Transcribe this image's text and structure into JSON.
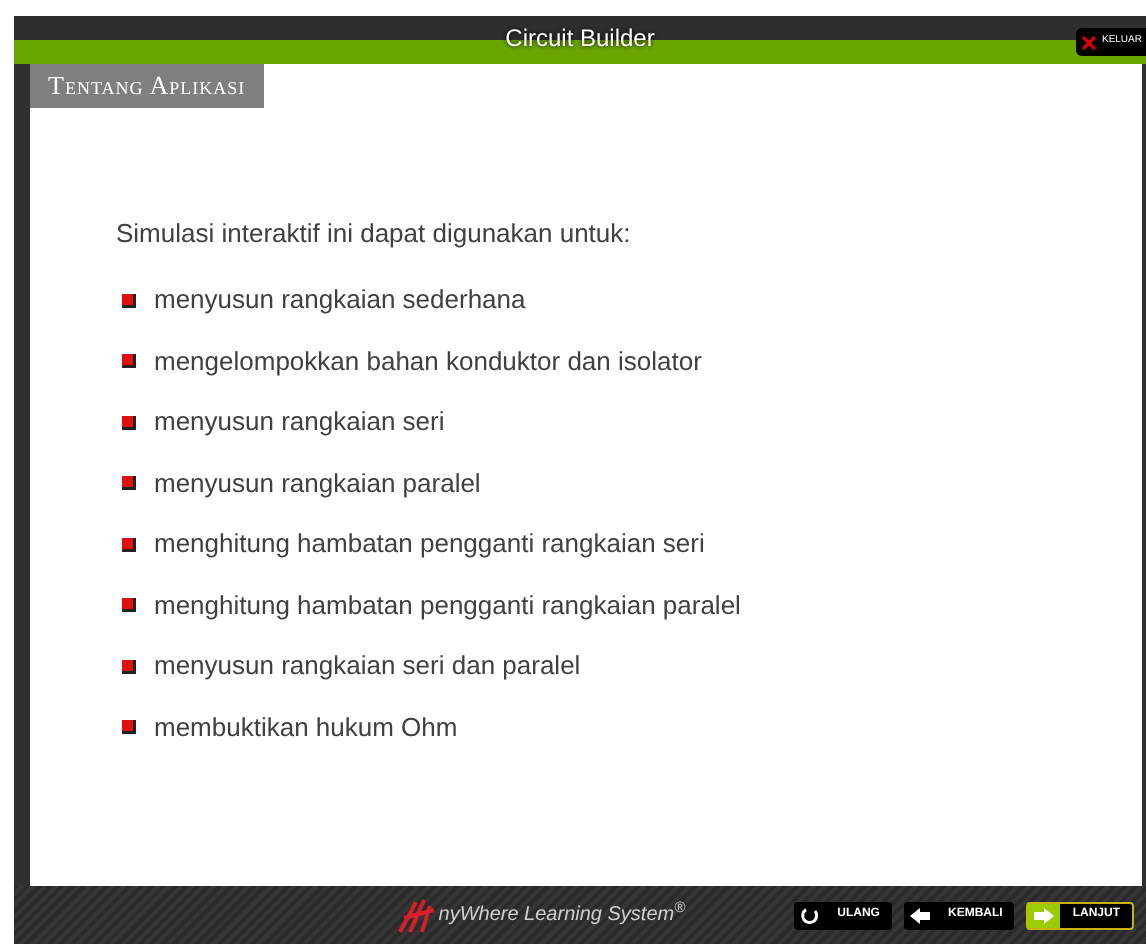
{
  "window": {
    "title": "Circuit Builder",
    "exit_label": "KELUAR"
  },
  "section_title": "Tentang Aplikasi",
  "intro": "Simulasi interaktif ini dapat digunakan untuk:",
  "items": [
    "menyusun rangkaian sederhana",
    "mengelompokkan bahan konduktor dan isolator",
    "menyusun rangkaian seri",
    "menyusun rangkaian paralel",
    "menghitung hambatan pengganti rangkaian seri",
    "menghitung hambatan pengganti rangkaian paralel",
    "menyusun rangkaian seri dan paralel",
    "membuktikan hukum Ohm"
  ],
  "footer": {
    "logo_text": "nyWhere Learning System$^{®}$",
    "buttons": [
      {
        "label": "ULANG",
        "kind": "reload",
        "highlighted": false
      },
      {
        "label": "KEMBALI",
        "kind": "back",
        "highlighted": false
      },
      {
        "label": "LANJUT",
        "kind": "next",
        "highlighted": true
      }
    ]
  }
}
